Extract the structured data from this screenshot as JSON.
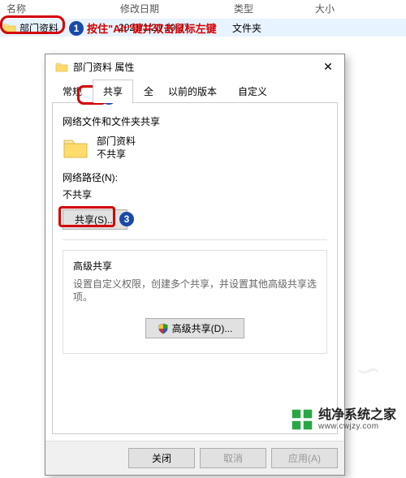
{
  "explorer": {
    "columns": {
      "name": "名称",
      "date": "修改日期",
      "type": "类型",
      "size": "大小"
    },
    "row": {
      "name": "部门资料",
      "date": "2021/1/20 10:37",
      "type": "文件夹"
    }
  },
  "annotations": {
    "step1": "1",
    "step1_text": "按住\"Alt\"键并双击鼠标左键",
    "step2": "2",
    "step3": "3"
  },
  "dialog": {
    "title": "部门资料 属性",
    "tabs": {
      "general": "常规",
      "sharing": "共享",
      "security": "安全",
      "prev": "以前的版本",
      "custom": "自定义"
    },
    "sharing": {
      "section_title": "网络文件和文件夹共享",
      "folder_name": "部门资料",
      "share_state": "不共享",
      "path_label": "网络路径(N):",
      "path_value": "不共享",
      "share_btn": "共享(S)..."
    },
    "advanced": {
      "title": "高级共享",
      "desc": "设置自定义权限，创建多个共享，并设置其他高级共享选项。",
      "btn": "高级共享(D)..."
    },
    "footer": {
      "close": "关闭",
      "cancel": "取消",
      "apply": "应用(A)"
    }
  },
  "brand": {
    "cn": "纯净系统之家",
    "url": "www.cwjzy.com"
  }
}
